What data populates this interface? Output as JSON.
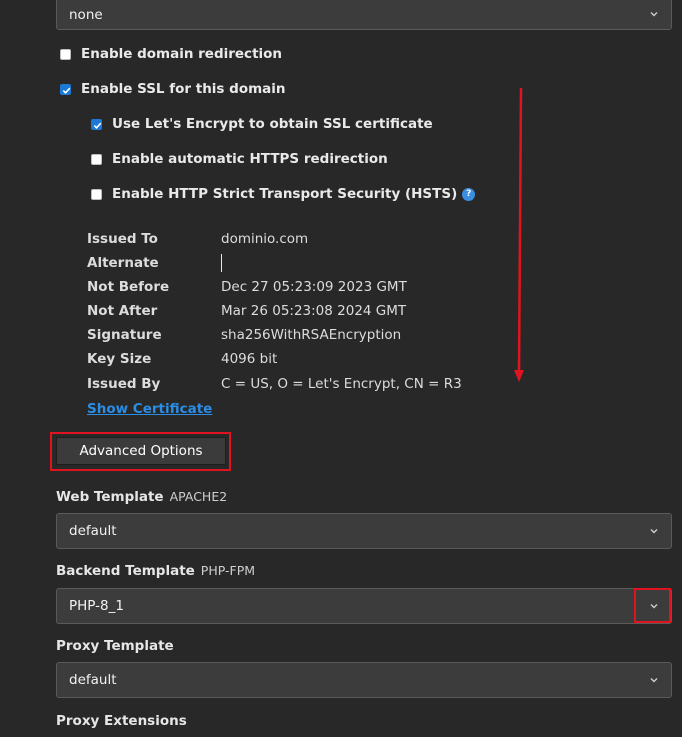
{
  "top_select": {
    "value": "none"
  },
  "checkboxes": {
    "domain_redirection": {
      "label": "Enable domain redirection",
      "checked": false
    },
    "ssl": {
      "label": "Enable SSL for this domain",
      "checked": true
    },
    "letsencrypt": {
      "label": "Use Let's Encrypt to obtain SSL certificate",
      "checked": true
    },
    "https_redirect": {
      "label": "Enable automatic HTTPS redirection",
      "checked": false
    },
    "hsts": {
      "label": "Enable HTTP Strict Transport Security (HSTS)",
      "checked": false,
      "help_glyph": "?"
    }
  },
  "certificate": {
    "issued_to": {
      "label": "Issued To",
      "value": "dominio.com"
    },
    "alternate": {
      "label": "Alternate",
      "value": ""
    },
    "not_before": {
      "label": "Not Before",
      "value": "Dec 27 05:23:09 2023 GMT"
    },
    "not_after": {
      "label": "Not After",
      "value": "Mar 26 05:23:08 2024 GMT"
    },
    "signature": {
      "label": "Signature",
      "value": "sha256WithRSAEncryption"
    },
    "key_size": {
      "label": "Key Size",
      "value": "4096 bit"
    },
    "issued_by": {
      "label": "Issued By",
      "value": "C = US, O = Let's Encrypt, CN = R3"
    },
    "show_link": "Show Certificate"
  },
  "advanced_button": "Advanced Options",
  "web_template": {
    "label": "Web Template",
    "hint": "APACHE2",
    "value": "default"
  },
  "backend_template": {
    "label": "Backend Template",
    "hint": "PHP-FPM",
    "value": "PHP-8_1"
  },
  "proxy_template": {
    "label": "Proxy Template",
    "value": "default"
  },
  "proxy_extensions": {
    "label": "Proxy Extensions"
  },
  "colors": {
    "accent": "#1d79d6",
    "highlight": "#e0141e",
    "background": "#282828"
  }
}
